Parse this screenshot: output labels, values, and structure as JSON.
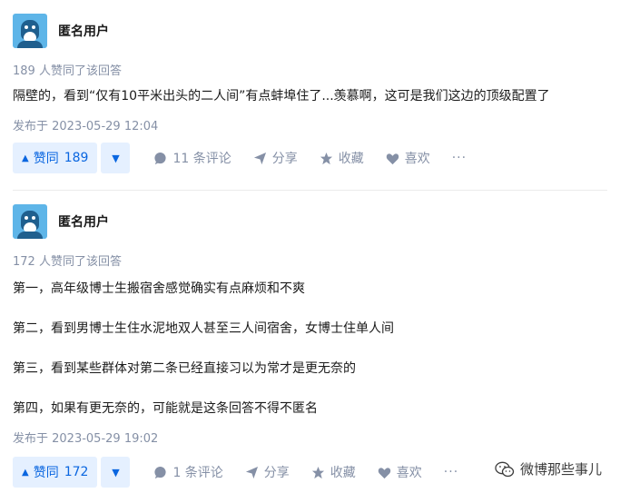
{
  "answers": [
    {
      "author": "匿名用户",
      "upvote_note": "189 人赞同了该回答",
      "paragraphs": [
        "隔壁的，看到“仅有10平米出头的二人间”有点蚌埠住了...羡慕啊，这可是我们这边的顶级配置了"
      ],
      "post_time": "发布于 2023-05-29 12:04",
      "vote_label": "赞同",
      "vote_count": "189",
      "comments": "11 条评论",
      "share": "分享",
      "collect": "收藏",
      "like": "喜欢",
      "more": "···"
    },
    {
      "author": "匿名用户",
      "upvote_note": "172 人赞同了该回答",
      "paragraphs": [
        "第一，高年级博士生搬宿舍感觉确实有点麻烦和不爽",
        "第二，看到男博士生住水泥地双人甚至三人间宿舍，女博士住单人间",
        "第三，看到某些群体对第二条已经直接习以为常才是更无奈的",
        "第四，如果有更无奈的，可能就是这条回答不得不匿名"
      ],
      "post_time": "发布于 2023-05-29 19:02",
      "vote_label": "赞同",
      "vote_count": "172",
      "comments": "1 条评论",
      "share": "分享",
      "collect": "收藏",
      "like": "喜欢",
      "more": "···"
    }
  ],
  "watermark": {
    "text": "微博那些事儿",
    "icon": "wechat-icon"
  },
  "colors": {
    "accent": "#0a66e0",
    "vote_bg": "#e5f0ff",
    "meta": "#8590a6"
  }
}
